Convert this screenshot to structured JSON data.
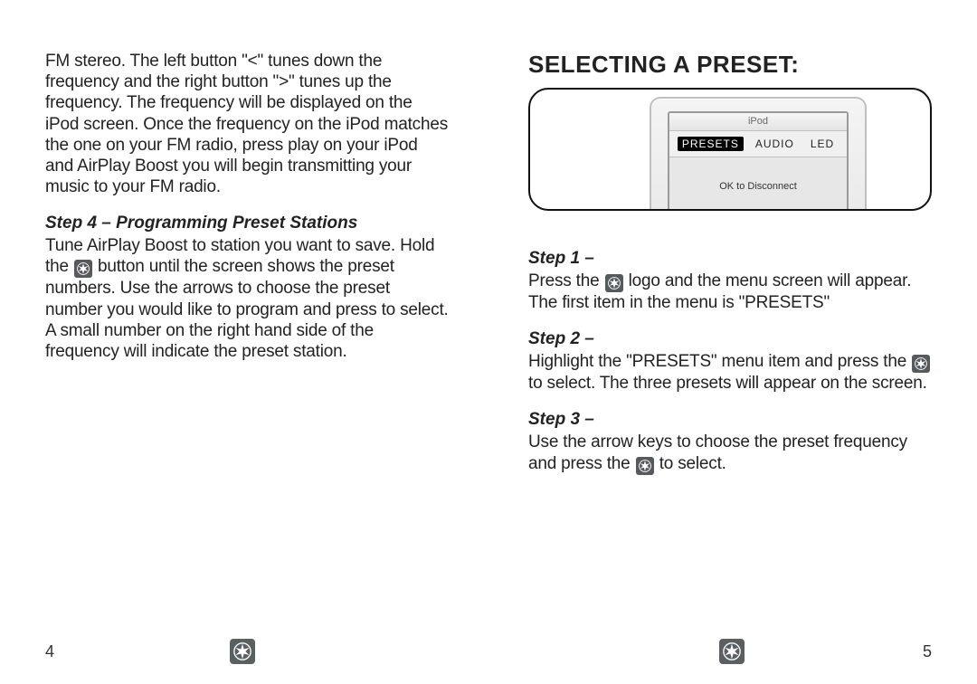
{
  "left": {
    "intro": "FM stereo. The left button \"<\" tunes down the frequency and the right button \">\" tunes up the frequency. The frequency will be displayed on the iPod screen. Once the frequency on the iPod matches the one on your FM radio, press play on your iPod and AirPlay Boost you will begin transmitting your music to your FM radio.",
    "step4_heading": "Step 4 – Programming Preset Stations",
    "step4_body_a": "Tune AirPlay Boost to station you want to save. Hold the ",
    "step4_body_b": " button until the screen shows the preset numbers. Use the arrows to choose the preset number you would like to program and press to select. A small number on the right hand side of the frequency will indicate the preset station.",
    "page_number": "4"
  },
  "right": {
    "heading": "SELECTING A PRESET:",
    "device": {
      "header": "iPod",
      "menu": {
        "presets": "PRESETS",
        "audio": "AUDIO",
        "led": "LED"
      },
      "ok_text": "OK to Disconnect"
    },
    "step1_heading": "Step 1 –",
    "step1_a": "Press the ",
    "step1_b": " logo and the menu screen will appear. The first item in the menu is \"PRESETS\"",
    "step2_heading": "Step 2 –",
    "step2_a": "Highlight the \"PRESETS\" menu item and press the ",
    "step2_b": " to select. The three presets will appear on the screen.",
    "step3_heading": "Step 3 –",
    "step3_a": "Use the arrow keys to choose the preset frequency and press the ",
    "step3_b": " to select.",
    "page_number": "5"
  }
}
